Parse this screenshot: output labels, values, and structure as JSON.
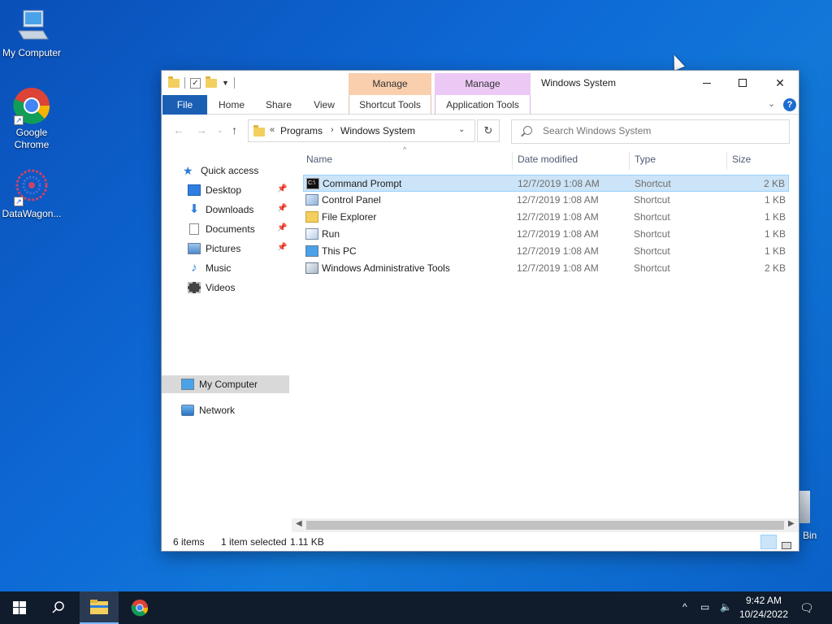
{
  "desktop": {
    "icons": [
      {
        "label": "My Computer"
      },
      {
        "label": "Google Chrome"
      },
      {
        "label": "DataWagon..."
      }
    ],
    "partial_label": "Bin"
  },
  "window": {
    "title": "Windows System",
    "contextual": [
      {
        "group": "Manage",
        "tab": "Shortcut Tools",
        "color": "#f9cfae"
      },
      {
        "group": "Manage",
        "tab": "Application Tools",
        "color": "#ecc9f5"
      }
    ],
    "ribbon_tabs": [
      "File",
      "Home",
      "Share",
      "View"
    ],
    "help": "?"
  },
  "address": {
    "prefix": "«",
    "crumbs": [
      "Programs",
      "Windows System"
    ],
    "search_placeholder": "Search Windows System"
  },
  "nav": {
    "quick_access": "Quick access",
    "items": [
      {
        "label": "Desktop",
        "pinned": true
      },
      {
        "label": "Downloads",
        "pinned": true
      },
      {
        "label": "Documents",
        "pinned": true
      },
      {
        "label": "Pictures",
        "pinned": true
      },
      {
        "label": "Music",
        "pinned": false
      },
      {
        "label": "Videos",
        "pinned": false
      }
    ],
    "my_computer": "My Computer",
    "network": "Network"
  },
  "columns": [
    "Name",
    "Date modified",
    "Type",
    "Size"
  ],
  "files": [
    {
      "name": "Command Prompt",
      "date": "12/7/2019 1:08 AM",
      "type": "Shortcut",
      "size": "2 KB",
      "icon": "cmd-icon"
    },
    {
      "name": "Control Panel",
      "date": "12/7/2019 1:08 AM",
      "type": "Shortcut",
      "size": "1 KB",
      "icon": "control-panel-icon"
    },
    {
      "name": "File Explorer",
      "date": "12/7/2019 1:08 AM",
      "type": "Shortcut",
      "size": "1 KB",
      "icon": "file-explorer-icon"
    },
    {
      "name": "Run",
      "date": "12/7/2019 1:08 AM",
      "type": "Shortcut",
      "size": "1 KB",
      "icon": "run-icon"
    },
    {
      "name": "This PC",
      "date": "12/7/2019 1:08 AM",
      "type": "Shortcut",
      "size": "1 KB",
      "icon": "this-pc-icon"
    },
    {
      "name": "Windows Administrative Tools",
      "date": "12/7/2019 1:08 AM",
      "type": "Shortcut",
      "size": "2 KB",
      "icon": "admin-tools-icon"
    }
  ],
  "status": {
    "items": "6 items",
    "selected": "1 item selected",
    "size": "1.11 KB"
  },
  "taskbar": {
    "time": "9:42 AM",
    "date": "10/24/2022"
  }
}
